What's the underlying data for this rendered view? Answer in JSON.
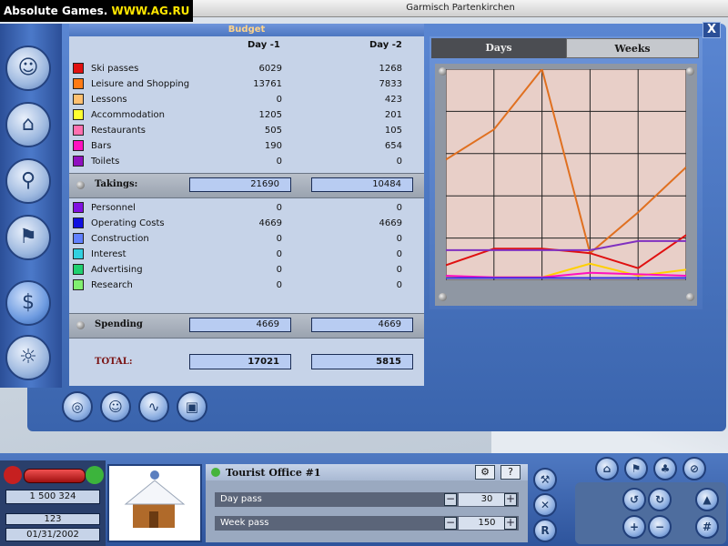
{
  "brand": {
    "prefix": "Absolute Games.",
    "highlight": "WWW.AG.RU"
  },
  "window": {
    "title": "Garmisch Partenkirchen",
    "close_label": "X"
  },
  "budget": {
    "title": "Budget",
    "col1": "Day -1",
    "col2": "Day -2",
    "income": [
      {
        "label": "Ski passes",
        "color": "#e01010",
        "d1": "6029",
        "d2": "1268"
      },
      {
        "label": "Leisure and Shopping",
        "color": "#ff7a14",
        "d1": "13761",
        "d2": "7833"
      },
      {
        "label": "Lessons",
        "color": "#ffc070",
        "d1": "0",
        "d2": "423"
      },
      {
        "label": "Accommodation",
        "color": "#ffff30",
        "d1": "1205",
        "d2": "201"
      },
      {
        "label": "Restaurants",
        "color": "#ff70b0",
        "d1": "505",
        "d2": "105"
      },
      {
        "label": "Bars",
        "color": "#ff10c0",
        "d1": "190",
        "d2": "654"
      },
      {
        "label": "Toilets",
        "color": "#9010c0",
        "d1": "0",
        "d2": "0"
      }
    ],
    "takings": {
      "label": "Takings:",
      "d1": "21690",
      "d2": "10484"
    },
    "expenses": [
      {
        "label": "Personnel",
        "color": "#8010e0",
        "d1": "0",
        "d2": "0"
      },
      {
        "label": "Operating Costs",
        "color": "#1010e0",
        "d1": "4669",
        "d2": "4669"
      },
      {
        "label": "Construction",
        "color": "#6080ff",
        "d1": "0",
        "d2": "0"
      },
      {
        "label": "Interest",
        "color": "#30d0e0",
        "d1": "0",
        "d2": "0"
      },
      {
        "label": "Advertising",
        "color": "#20d070",
        "d1": "0",
        "d2": "0"
      },
      {
        "label": "Research",
        "color": "#80f070",
        "d1": "0",
        "d2": "0"
      }
    ],
    "spending": {
      "label": "Spending",
      "d1": "4669",
      "d2": "4669"
    },
    "total": {
      "label": "TOTAL:",
      "d1": "17021",
      "d2": "5815"
    }
  },
  "graph": {
    "tabs": [
      "Days",
      "Weeks"
    ],
    "active_tab": "Days",
    "background": "#e8cfc8"
  },
  "chart_data": {
    "type": "line",
    "x": [
      1,
      2,
      3,
      4,
      5,
      6
    ],
    "ylim": [
      0,
      14000
    ],
    "grid": true,
    "series": [
      {
        "color": "#e07020",
        "values": [
          8000,
          10000,
          14000,
          1800,
          4500,
          7500
        ]
      },
      {
        "color": "#e01010",
        "values": [
          1000,
          2100,
          2100,
          1800,
          800,
          3000
        ]
      },
      {
        "color": "#8030c0",
        "values": [
          2000,
          2000,
          2000,
          2000,
          2600,
          2600
        ]
      },
      {
        "color": "#ffd000",
        "values": [
          200,
          200,
          200,
          1100,
          300,
          700
        ]
      },
      {
        "color": "#ff10c0",
        "values": [
          300,
          200,
          200,
          500,
          400,
          300
        ]
      },
      {
        "color": "#3030e0",
        "values": [
          150,
          150,
          150,
          150,
          150,
          150
        ]
      }
    ]
  },
  "left_nav": [
    {
      "name": "guests-button",
      "glyph": "☺"
    },
    {
      "name": "buildings-button",
      "glyph": "⌂"
    },
    {
      "name": "lifts-button",
      "glyph": "⚲"
    },
    {
      "name": "slopes-button",
      "glyph": "⚑"
    },
    {
      "name": "finances-button",
      "glyph": "$"
    },
    {
      "name": "weather-button",
      "glyph": "☼"
    }
  ],
  "bottom_tabs": [
    {
      "name": "budget-tab-button",
      "glyph": "◎"
    },
    {
      "name": "stats-tab-button",
      "glyph": "☺"
    },
    {
      "name": "graph-tab-button",
      "glyph": "∿"
    },
    {
      "name": "overview-tab-button",
      "glyph": "▣"
    }
  ],
  "status": {
    "money": "1 500 324",
    "count": "123",
    "date": "01/31/2002"
  },
  "building": {
    "title": "Tourist Office #1",
    "rows": [
      {
        "label": "Day pass",
        "value": "30"
      },
      {
        "label": "Week pass",
        "value": "150"
      }
    ],
    "minus": "−",
    "plus": "+"
  },
  "side_buttons": [
    "R"
  ]
}
